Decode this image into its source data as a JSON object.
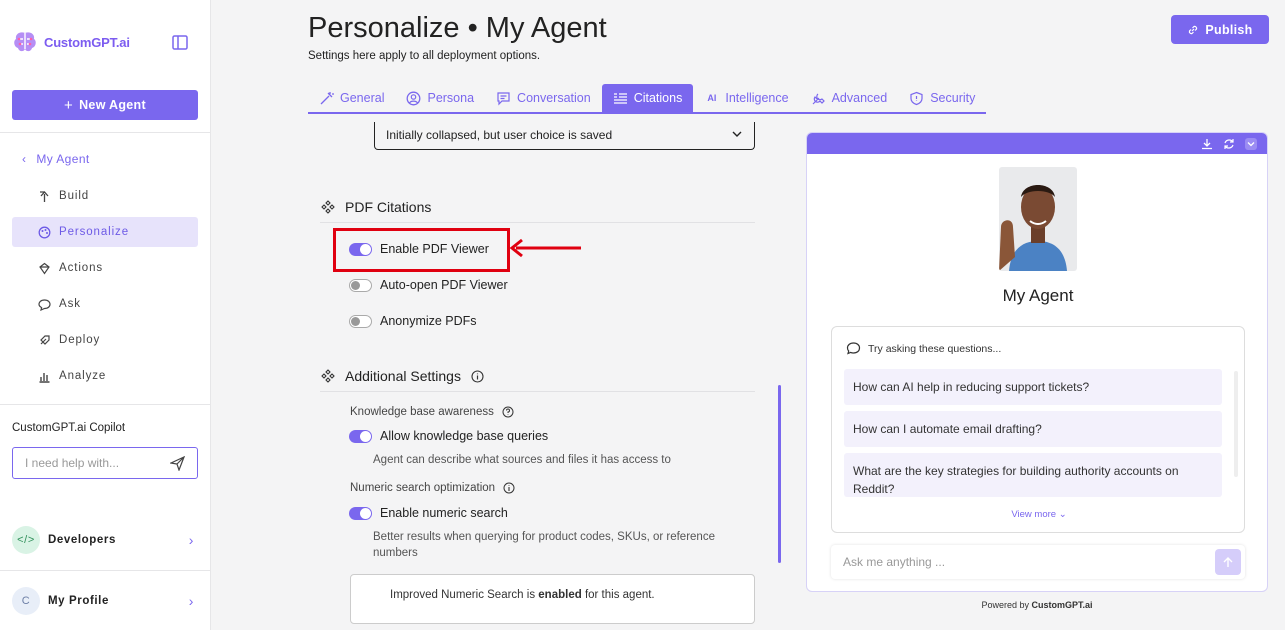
{
  "sidebar": {
    "logo_text": "CustomGPT.ai",
    "new_agent_label": "New Agent",
    "back_label": "My Agent",
    "nav": [
      {
        "label": "Build",
        "icon": "build-icon"
      },
      {
        "label": "Personalize",
        "icon": "palette-icon"
      },
      {
        "label": "Actions",
        "icon": "actions-icon"
      },
      {
        "label": "Ask",
        "icon": "chat-icon"
      },
      {
        "label": "Deploy",
        "icon": "rocket-icon"
      },
      {
        "label": "Analyze",
        "icon": "chart-icon"
      }
    ],
    "active_nav": "Personalize",
    "copilot": {
      "title": "CustomGPT.ai Copilot",
      "placeholder": "I need help with..."
    },
    "developers_label": "Developers",
    "profile_label": "My Profile",
    "profile_initial": "C"
  },
  "header": {
    "title": "Personalize • My Agent",
    "subtitle": "Settings here apply to all deployment options.",
    "publish_label": "Publish"
  },
  "tabs": [
    {
      "label": "General",
      "icon": "wand-icon"
    },
    {
      "label": "Persona",
      "icon": "user-circle-icon"
    },
    {
      "label": "Conversation",
      "icon": "message-icon"
    },
    {
      "label": "Citations",
      "icon": "citations-icon"
    },
    {
      "label": "Intelligence",
      "icon": "ai-icon"
    },
    {
      "label": "Advanced",
      "icon": "tools-icon"
    },
    {
      "label": "Security",
      "icon": "shield-icon"
    }
  ],
  "active_tab": "Citations",
  "settings": {
    "select_value": "Initially collapsed, but user choice is saved",
    "pdf_section_title": "PDF Citations",
    "enable_pdf_viewer": {
      "label": "Enable PDF Viewer",
      "on": true
    },
    "auto_open_pdf": {
      "label": "Auto-open PDF Viewer",
      "on": false
    },
    "anonymize_pdfs": {
      "label": "Anonymize PDFs",
      "on": false
    },
    "additional_title": "Additional Settings",
    "kb_awareness_label": "Knowledge base awareness",
    "allow_kb": {
      "label": "Allow knowledge base queries",
      "on": true
    },
    "allow_kb_desc": "Agent can describe what sources and files it has access to",
    "numeric_label": "Numeric search optimization",
    "enable_numeric": {
      "label": "Enable numeric search",
      "on": true
    },
    "numeric_desc": "Better results when querying for product codes, SKUs, or reference numbers",
    "info_prefix": "Improved Numeric Search is ",
    "info_bold": "enabled",
    "info_suffix": " for this agent."
  },
  "preview": {
    "agent_name": "My Agent",
    "try_asking": "Try asking these questions...",
    "questions": [
      "How can AI help in reducing support tickets?",
      "How can I automate email drafting?",
      "What are the key strategies for building authority accounts on Reddit?"
    ],
    "view_more": "View more",
    "input_placeholder": "Ask me anything ...",
    "powered_prefix": "Powered by ",
    "powered_brand": "CustomGPT.ai"
  },
  "colors": {
    "accent": "#7a67ee",
    "highlight": "#e00010"
  }
}
